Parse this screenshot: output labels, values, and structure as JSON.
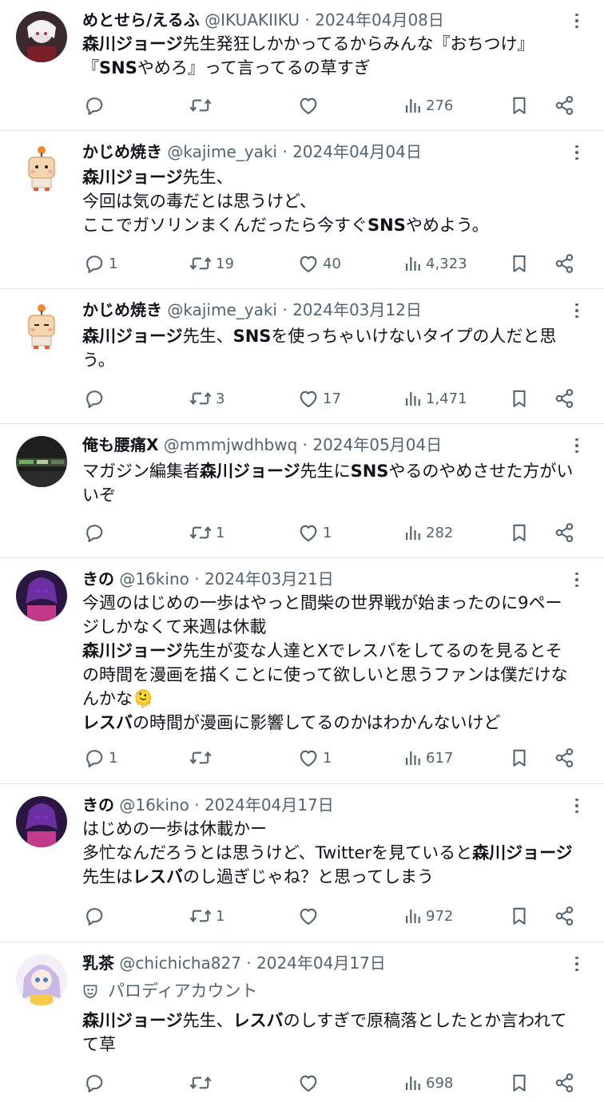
{
  "tweets": [
    {
      "name": "めとせら/えるふ",
      "handle": "@IKUAKIIKU",
      "date": "2024年04月08日",
      "lines": [
        [
          {
            "t": "森川ジョージ",
            "b": true
          },
          {
            "t": "先生発狂しかかってるからみんな『おちつけ』",
            "b": false
          }
        ],
        [
          {
            "t": "『",
            "b": false
          },
          {
            "t": "SNS",
            "b": true
          },
          {
            "t": "やめろ』って言ってるの草すぎ",
            "b": false
          }
        ]
      ],
      "reply": "",
      "retweet": "",
      "like": "",
      "views": "276"
    },
    {
      "name": "かじめ焼き",
      "handle": "@kajime_yaki",
      "date": "2024年04月04日",
      "lines": [
        [
          {
            "t": "森川ジョージ",
            "b": true
          },
          {
            "t": "先生、",
            "b": false
          }
        ],
        [
          {
            "t": "今回は気の毒だとは思うけど、",
            "b": false
          }
        ],
        [
          {
            "t": "ここでガソリンまくんだったら今すぐ",
            "b": false
          },
          {
            "t": "SNS",
            "b": true
          },
          {
            "t": "やめよう。",
            "b": false
          }
        ]
      ],
      "reply": "1",
      "retweet": "19",
      "like": "40",
      "views": "4,323"
    },
    {
      "name": "かじめ焼き",
      "handle": "@kajime_yaki",
      "date": "2024年03月12日",
      "lines": [
        [
          {
            "t": "森川ジョージ",
            "b": true
          },
          {
            "t": "先生、",
            "b": false
          },
          {
            "t": "SNS",
            "b": true
          },
          {
            "t": "を使っちゃいけないタイプの人だと思",
            "b": false
          }
        ],
        [
          {
            "t": "う。",
            "b": false
          }
        ]
      ],
      "reply": "",
      "retweet": "3",
      "like": "17",
      "views": "1,471"
    },
    {
      "name": "俺も腰痛X",
      "handle": "@mmmjwdhbwq",
      "date": "2024年05月04日",
      "lines": [
        [
          {
            "t": "マガジン編集者",
            "b": false
          },
          {
            "t": "森川ジョージ",
            "b": true
          },
          {
            "t": "先生に",
            "b": false
          },
          {
            "t": "SNS",
            "b": true
          },
          {
            "t": "やるのやめさせた方がい",
            "b": false
          }
        ],
        [
          {
            "t": "いぞ",
            "b": false
          }
        ]
      ],
      "reply": "",
      "retweet": "1",
      "like": "1",
      "views": "282"
    },
    {
      "name": "きの",
      "handle": "@16kino",
      "date": "2024年03月21日",
      "lines": [
        [
          {
            "t": "今週のはじめの一歩はやっと間柴の世界戦が始まったのに9ペー",
            "b": false
          }
        ],
        [
          {
            "t": "ジしかなくて来週は休載",
            "b": false
          }
        ],
        [
          {
            "t": "森川ジョージ",
            "b": true
          },
          {
            "t": "先生が変な人達とXでレスバをしてるのを見るとそ",
            "b": false
          }
        ],
        [
          {
            "t": "の時間を漫画を描くことに使って欲しいと思うファンは僕だけな",
            "b": false
          }
        ],
        [
          {
            "t": "んかな🫠",
            "b": false
          }
        ],
        [
          {
            "t": "レスバ",
            "b": true
          },
          {
            "t": "の時間が漫画に影響してるのかはわかんないけど",
            "b": false
          }
        ]
      ],
      "reply": "1",
      "retweet": "",
      "like": "1",
      "views": "617"
    },
    {
      "name": "きの",
      "handle": "@16kino",
      "date": "2024年04月17日",
      "lines": [
        [
          {
            "t": "はじめの一歩は休載かー",
            "b": false
          }
        ],
        [
          {
            "t": "多忙なんだろうとは思うけど、Twitterを見ていると",
            "b": false
          },
          {
            "t": "森川ジョージ",
            "b": true
          }
        ],
        [
          {
            "t": "先生は",
            "b": false
          },
          {
            "t": "レスバ",
            "b": true
          },
          {
            "t": "のし過ぎじゃね？と思ってしまう",
            "b": false
          }
        ]
      ],
      "reply": "",
      "retweet": "1",
      "like": "",
      "views": "972"
    },
    {
      "name": "乳茶",
      "handle": "@chichicha827",
      "date": "2024年04月17日",
      "badge": "パロディアカウント",
      "lines": [
        [
          {
            "t": "森川ジョージ",
            "b": true
          },
          {
            "t": "先生、",
            "b": false
          },
          {
            "t": "レスバ",
            "b": true
          },
          {
            "t": "のしすぎで原稿落としたとか言われて",
            "b": false
          }
        ],
        [
          {
            "t": "て草",
            "b": false
          }
        ]
      ],
      "reply": "",
      "retweet": "",
      "like": "",
      "views": "698"
    }
  ],
  "colors": {
    "text": "#0f1419",
    "secondary": "#536471",
    "divider": "#e1e6ea"
  },
  "icons": [
    "reply-icon",
    "retweet-icon",
    "like-icon",
    "views-icon",
    "bookmark-icon",
    "share-icon",
    "more-icon",
    "parody-mask-icon"
  ]
}
